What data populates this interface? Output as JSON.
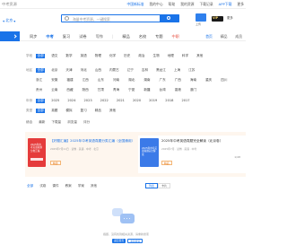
{
  "topbar": {
    "site": "中考资源",
    "links": [
      "中国新标准",
      "我的中心",
      "帮助",
      "我的资源",
      "下载记录",
      "APP下载",
      "更多"
    ]
  },
  "header": {
    "region": "北京",
    "search_placeholder": "海量中考资源，一键搜索",
    "upload_label": "上传",
    "vip_label": "VIP",
    "more_label": "更多"
  },
  "nav": {
    "items": [
      "同步",
      "中考",
      "复习",
      "试卷",
      "写作",
      "|",
      "精品",
      "名校",
      "专题",
      "中职"
    ],
    "active_index": 1,
    "hot_index": 9,
    "right": [
      "首页",
      "精品",
      "成员"
    ]
  },
  "filters": {
    "row1": {
      "label": "学段",
      "items": [
        "全部",
        "语文",
        "数学",
        "英语",
        "物理",
        "化学",
        "历史",
        "政治",
        "生物",
        "地理",
        "科学",
        "其他"
      ]
    },
    "row2": {
      "label": "地区",
      "items": [
        "全部",
        "北京",
        "天津",
        "河北",
        "山西",
        "内蒙古",
        "辽宁",
        "吉林",
        "黑龙江",
        "上海",
        "江苏"
      ]
    },
    "row2b": [
      "浙江",
      "安徽",
      "福建",
      "江西",
      "山东",
      "河南",
      "湖北",
      "湖南",
      "广东",
      "广西",
      "海南",
      "重庆",
      "四川"
    ],
    "row2c": [
      "贵州",
      "云南",
      "西藏",
      "陕西",
      "甘肃",
      "青海",
      "宁夏",
      "新疆",
      "台湾",
      "香港",
      "澳门"
    ],
    "row3": {
      "label": "年份",
      "items": [
        "全部",
        "2025",
        "2024",
        "2023",
        "2022",
        "2021",
        "2020",
        "2019",
        "2018",
        "2017"
      ]
    },
    "row4": {
      "label": "类型",
      "items": [
        "全部",
        "真题",
        "模拟",
        "复习",
        "精品",
        "其他"
      ]
    }
  },
  "sort": {
    "items": [
      "综合",
      "最新",
      "下载量",
      "浏览量",
      "评分"
    ]
  },
  "cards": [
    {
      "thumb_text": "2025年中考英语真题分类汇编",
      "title": "【好题汇编】2025年中考英语真题分类汇编（全国通用）",
      "meta": "2025年7月11日 · 试卷 · 英语 · 中考 · 北京",
      "tag": "精选"
    },
    {
      "thumb_text": "2025年中考英语真题完全解读",
      "title": "2025年中考英语真题完全解读（北京卷）",
      "meta": "2025年7月 · 试卷 · 英语 · 中考",
      "tag": "精品",
      "next_label": "1/48"
    }
  ],
  "lower_tabs": {
    "items": [
      "全部",
      "试卷",
      "课件",
      "教案",
      "学案",
      "其他"
    ],
    "active_index": 0,
    "toggle": [
      "列表",
      "卡片"
    ]
  },
  "empty": {
    "message": "抱歉，没有找到相关资源，请重新搜索",
    "buttons": [
      "返回首页",
      "重新搜索"
    ]
  }
}
